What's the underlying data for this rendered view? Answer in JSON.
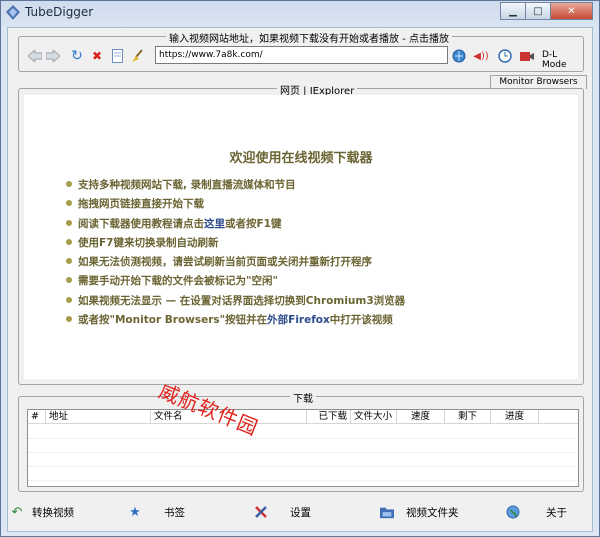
{
  "window": {
    "title": "TubeDigger"
  },
  "nav": {
    "caption": "输入视频网站地址，如果视频下载没有开始或者播放 - 点击播放",
    "url": "https://www.7a8k.com/",
    "dl_mode_label": "D-L Mode",
    "icons": [
      "back-arrow-icon",
      "forward-arrow-icon",
      "refresh-icon",
      "stop-icon",
      "page-icon",
      "clear-broom-icon",
      "go-globe-icon",
      "record-sound-icon",
      "clock-icon",
      "camera-record-icon"
    ]
  },
  "tabs": {
    "monitor_label": "Monitor Browsers"
  },
  "browser": {
    "caption": "网页 | IExplorer",
    "welcome_title": "欢迎使用在线视频下载器",
    "bullets": [
      {
        "text": "支持多种视频网站下载, 录制直播流媒体和节目"
      },
      {
        "text": "拖拽网页链接直接开始下载"
      },
      {
        "pre": "阅读下载器使用教程请点击",
        "link": "这里",
        "post": "或者按F1键"
      },
      {
        "text": "使用F7键来切换录制自动刷新"
      },
      {
        "text": "如果无法侦测视频，请尝试刷新当前页面或关闭并重新打开程序"
      },
      {
        "text": "需要手动开始下载的文件会被标记为\"空闲\""
      },
      {
        "text": "如果视频无法显示 — 在设置对话界面选择切换到Chromium3浏览器"
      },
      {
        "pre": "或者按\"Monitor Browsers\"按钮并在",
        "link": "外部Firefox",
        "post": "中打开该视频"
      }
    ]
  },
  "downloads": {
    "caption": "下载",
    "columns": [
      "#",
      "地址",
      "文件名",
      "已下载",
      "文件大小",
      "速度",
      "剩下",
      "进度"
    ]
  },
  "bottom": {
    "buttons": [
      {
        "label": "转换视频",
        "icon": "convert-icon"
      },
      {
        "label": "书签",
        "icon": "star-icon"
      },
      {
        "label": "设置",
        "icon": "settings-tools-icon"
      },
      {
        "label": "视频文件夹",
        "icon": "folder-icon"
      },
      {
        "label": "关于",
        "icon": "globe-about-icon"
      }
    ]
  },
  "watermark": "威航软件园",
  "colors": {
    "accent_text": "#6b6534",
    "link": "#2d4a8a",
    "watermark": "#e0241d"
  }
}
